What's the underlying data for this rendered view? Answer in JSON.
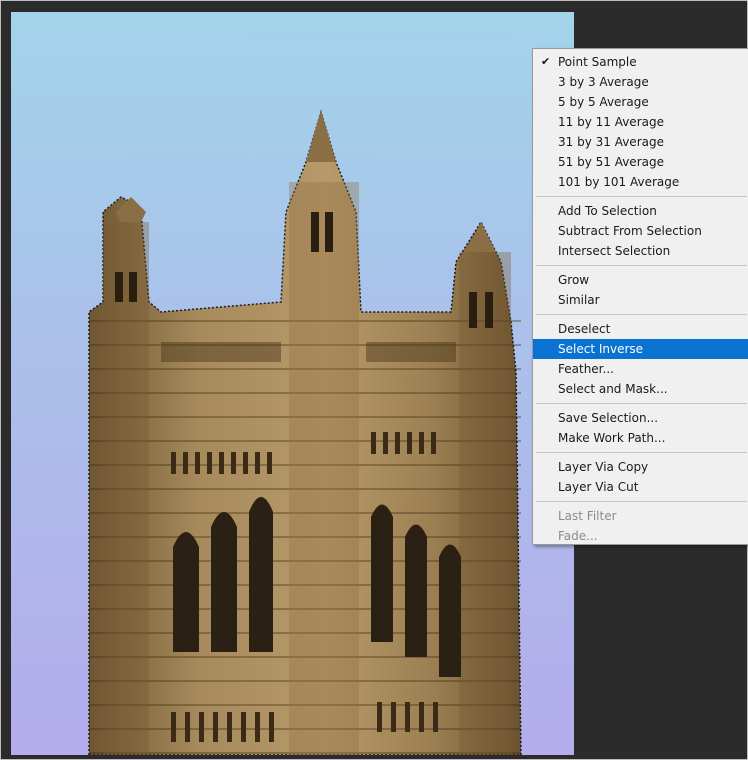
{
  "menu": {
    "groups": [
      [
        {
          "label": "Point Sample",
          "checked": true
        },
        {
          "label": "3 by 3 Average"
        },
        {
          "label": "5 by 5 Average"
        },
        {
          "label": "11 by 11 Average"
        },
        {
          "label": "31 by 31 Average"
        },
        {
          "label": "51 by 51 Average"
        },
        {
          "label": "101 by 101 Average"
        }
      ],
      [
        {
          "label": "Add To Selection"
        },
        {
          "label": "Subtract From Selection"
        },
        {
          "label": "Intersect Selection"
        }
      ],
      [
        {
          "label": "Grow"
        },
        {
          "label": "Similar"
        }
      ],
      [
        {
          "label": "Deselect"
        },
        {
          "label": "Select Inverse",
          "highlighted": true
        },
        {
          "label": "Feather..."
        },
        {
          "label": "Select and Mask..."
        }
      ],
      [
        {
          "label": "Save Selection..."
        },
        {
          "label": "Make Work Path..."
        }
      ],
      [
        {
          "label": "Layer Via Copy"
        },
        {
          "label": "Layer Via Cut"
        }
      ],
      [
        {
          "label": "Last Filter",
          "disabled": true
        },
        {
          "label": "Fade...",
          "disabled": true
        }
      ]
    ]
  },
  "colors": {
    "sky_top": "#a2d4ea",
    "sky_bottom": "#b4acec",
    "stone": "#a1865a",
    "menu_bg": "#f0f0f0",
    "highlight": "#0a73d1",
    "workspace": "#2b2b2b"
  }
}
